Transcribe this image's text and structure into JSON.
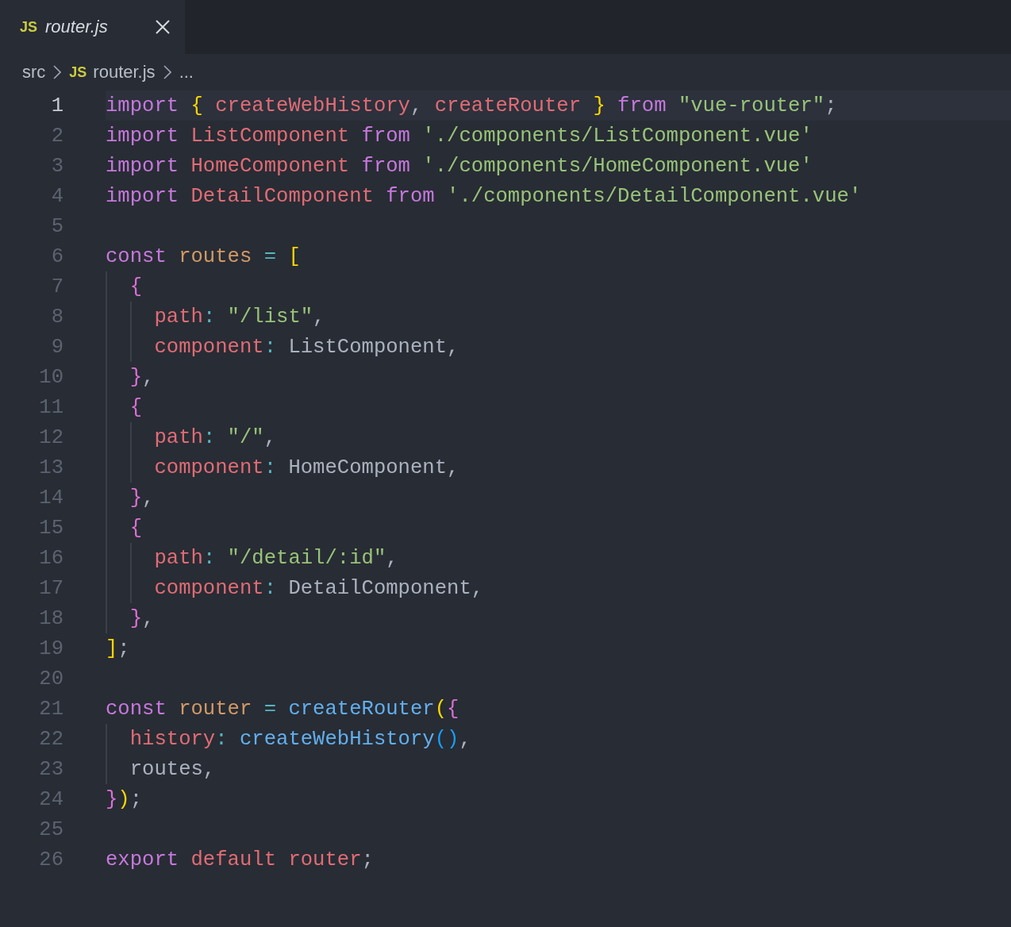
{
  "tabs": [
    {
      "badge": "JS",
      "label": "router.js",
      "preview": true
    }
  ],
  "breadcrumb": [
    {
      "kind": "folder",
      "label": "src"
    },
    {
      "kind": "file",
      "badge": "JS",
      "label": "router.js"
    },
    {
      "kind": "more",
      "label": "..."
    }
  ],
  "lines": [
    {
      "number": "1",
      "current": true,
      "tokens": [
        {
          "kind": "keyword",
          "text": "import "
        },
        {
          "kind": "bracket1",
          "text": "{"
        },
        {
          "kind": "variable",
          "text": " createWebHistory"
        },
        {
          "kind": "plain",
          "text": ", "
        },
        {
          "kind": "variable",
          "text": "createRouter "
        },
        {
          "kind": "bracket1",
          "text": "} "
        },
        {
          "kind": "keyword",
          "text": "from "
        },
        {
          "kind": "string",
          "text": "\"vue-router\""
        },
        {
          "kind": "plain",
          "text": ";"
        }
      ]
    },
    {
      "number": "2",
      "current": false,
      "tokens": [
        {
          "kind": "keyword",
          "text": "import"
        },
        {
          "kind": "variable",
          "text": " ListComponent "
        },
        {
          "kind": "keyword",
          "text": "from"
        },
        {
          "kind": "string",
          "text": " './components/ListComponent.vue'"
        }
      ]
    },
    {
      "number": "3",
      "current": false,
      "tokens": [
        {
          "kind": "keyword",
          "text": "import"
        },
        {
          "kind": "variable",
          "text": " HomeComponent "
        },
        {
          "kind": "keyword",
          "text": "from"
        },
        {
          "kind": "string",
          "text": " './components/HomeComponent.vue'"
        }
      ]
    },
    {
      "number": "4",
      "current": false,
      "tokens": [
        {
          "kind": "keyword",
          "text": "import"
        },
        {
          "kind": "variable",
          "text": " DetailComponent "
        },
        {
          "kind": "keyword",
          "text": "from"
        },
        {
          "kind": "string",
          "text": " './components/DetailComponent.vue'"
        }
      ]
    },
    {
      "number": "5",
      "current": false
    },
    {
      "number": "6",
      "current": false,
      "tokens": [
        {
          "kind": "keyword",
          "text": "const"
        },
        {
          "kind": "constant",
          "text": " routes "
        },
        {
          "kind": "operator",
          "text": "= "
        },
        {
          "kind": "bracket1",
          "text": "["
        }
      ]
    },
    {
      "number": "7",
      "current": false,
      "tokens": [
        {
          "kind": "bracket2",
          "text": "  {"
        }
      ]
    },
    {
      "number": "8",
      "current": false,
      "tokens": [
        {
          "kind": "property",
          "text": "    path"
        },
        {
          "kind": "operator",
          "text": ": "
        },
        {
          "kind": "string",
          "text": "\"/list\""
        },
        {
          "kind": "plain",
          "text": ","
        }
      ]
    },
    {
      "number": "9",
      "current": false,
      "tokens": [
        {
          "kind": "property",
          "text": "    component"
        },
        {
          "kind": "operator",
          "text": ": "
        },
        {
          "kind": "plain",
          "text": "ListComponent,"
        }
      ]
    },
    {
      "number": "10",
      "current": false,
      "tokens": [
        {
          "kind": "bracket2",
          "text": "  }"
        },
        {
          "kind": "plain",
          "text": ","
        }
      ]
    },
    {
      "number": "11",
      "current": false,
      "tokens": [
        {
          "kind": "bracket2",
          "text": "  {"
        }
      ]
    },
    {
      "number": "12",
      "current": false,
      "tokens": [
        {
          "kind": "property",
          "text": "    path"
        },
        {
          "kind": "operator",
          "text": ": "
        },
        {
          "kind": "string",
          "text": "\"/\""
        },
        {
          "kind": "plain",
          "text": ","
        }
      ]
    },
    {
      "number": "13",
      "current": false,
      "tokens": [
        {
          "kind": "property",
          "text": "    component"
        },
        {
          "kind": "operator",
          "text": ": "
        },
        {
          "kind": "plain",
          "text": "HomeComponent,"
        }
      ]
    },
    {
      "number": "14",
      "current": false,
      "tokens": [
        {
          "kind": "bracket2",
          "text": "  }"
        },
        {
          "kind": "plain",
          "text": ","
        }
      ]
    },
    {
      "number": "15",
      "current": false,
      "tokens": [
        {
          "kind": "bracket2",
          "text": "  {"
        }
      ]
    },
    {
      "number": "16",
      "current": false,
      "tokens": [
        {
          "kind": "property",
          "text": "    path"
        },
        {
          "kind": "operator",
          "text": ": "
        },
        {
          "kind": "string",
          "text": "\"/detail/:id\""
        },
        {
          "kind": "plain",
          "text": ","
        }
      ]
    },
    {
      "number": "17",
      "current": false,
      "tokens": [
        {
          "kind": "property",
          "text": "    component"
        },
        {
          "kind": "operator",
          "text": ": "
        },
        {
          "kind": "plain",
          "text": "DetailComponent,"
        }
      ]
    },
    {
      "number": "18",
      "current": false,
      "tokens": [
        {
          "kind": "bracket2",
          "text": "  }"
        },
        {
          "kind": "plain",
          "text": ","
        }
      ]
    },
    {
      "number": "19",
      "current": false,
      "tokens": [
        {
          "kind": "bracket1",
          "text": "]"
        },
        {
          "kind": "plain",
          "text": ";"
        }
      ]
    },
    {
      "number": "20",
      "current": false
    },
    {
      "number": "21",
      "current": false,
      "tokens": [
        {
          "kind": "keyword",
          "text": "const"
        },
        {
          "kind": "constant",
          "text": " router "
        },
        {
          "kind": "operator",
          "text": "="
        },
        {
          "kind": "function",
          "text": " createRouter"
        },
        {
          "kind": "bracket1",
          "text": "("
        },
        {
          "kind": "bracket2",
          "text": "{"
        }
      ]
    },
    {
      "number": "22",
      "current": false,
      "tokens": [
        {
          "kind": "property",
          "text": "  history"
        },
        {
          "kind": "operator",
          "text": ": "
        },
        {
          "kind": "function",
          "text": "createWebHistory"
        },
        {
          "kind": "bracket3",
          "text": "()"
        },
        {
          "kind": "plain",
          "text": ","
        }
      ]
    },
    {
      "number": "23",
      "current": false,
      "tokens": [
        {
          "kind": "plain",
          "text": "  routes,"
        }
      ]
    },
    {
      "number": "24",
      "current": false,
      "tokens": [
        {
          "kind": "bracket2",
          "text": "}"
        },
        {
          "kind": "bracket1",
          "text": ")"
        },
        {
          "kind": "plain",
          "text": ";"
        }
      ]
    },
    {
      "number": "25",
      "current": false
    },
    {
      "number": "26",
      "current": false,
      "tokens": [
        {
          "kind": "keyword",
          "text": "export"
        },
        {
          "kind": "variable",
          "text": " default router"
        },
        {
          "kind": "plain",
          "text": ";"
        }
      ]
    }
  ]
}
